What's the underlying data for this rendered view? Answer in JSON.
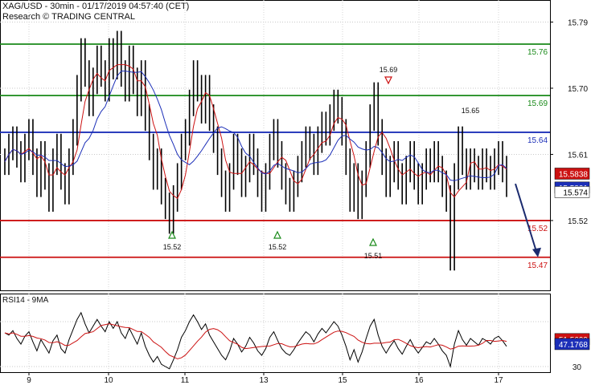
{
  "header": {
    "line1": "XAG/USD - 30min - 01/17/2019 04:57:40 (CET)",
    "line2": "Research © TRADING CENTRAL"
  },
  "chart_data": [
    {
      "type": "line",
      "title": "XAG/USD - 30min",
      "ylim": [
        15.425,
        15.82
      ],
      "y_ticks": [
        "15.79",
        "15.70",
        "15.61",
        "15.52"
      ],
      "x_ticks": [
        "9",
        "10",
        "11",
        "13",
        "15",
        "16",
        "17"
      ],
      "grid": true,
      "series": [
        {
          "values": [
            15.6,
            15.62,
            15.63,
            15.61,
            15.59,
            15.62,
            15.64,
            15.6,
            15.57,
            15.61,
            15.58,
            15.55,
            15.6,
            15.62,
            15.58,
            15.56,
            15.6,
            15.64,
            15.7,
            15.75,
            15.72,
            15.68,
            15.71,
            15.74,
            15.72,
            15.7,
            15.75,
            15.73,
            15.76,
            15.72,
            15.7,
            15.74,
            15.71,
            15.68,
            15.72,
            15.66,
            15.62,
            15.58,
            15.6,
            15.56,
            15.54,
            15.52,
            15.55,
            15.58,
            15.62,
            15.64,
            15.68,
            15.72,
            15.7,
            15.67,
            15.7,
            15.66,
            15.63,
            15.6,
            15.57,
            15.55,
            15.58,
            15.62,
            15.6,
            15.57,
            15.59,
            15.62,
            15.6,
            15.57,
            15.55,
            15.58,
            15.62,
            15.64,
            15.61,
            15.58,
            15.56,
            15.55,
            15.57,
            15.59,
            15.61,
            15.63,
            15.62,
            15.6,
            15.63,
            15.65,
            15.64,
            15.66,
            15.68,
            15.67,
            15.64,
            15.6,
            15.55,
            15.58,
            15.54,
            15.57,
            15.61,
            15.66,
            15.69,
            15.64,
            15.6,
            15.57,
            15.59,
            15.61,
            15.58,
            15.56,
            15.59,
            15.61,
            15.58,
            15.56,
            15.58,
            15.6,
            15.59,
            15.61,
            15.59,
            15.57,
            15.55,
            15.47,
            15.58,
            15.63,
            15.6,
            15.58,
            15.6,
            15.59,
            15.58,
            15.6,
            15.59,
            15.58,
            15.6,
            15.61,
            15.59,
            15.57
          ]
        },
        {
          "name": "RSI14",
          "values": [
            60,
            58,
            62,
            55,
            50,
            57,
            61,
            52,
            44,
            54,
            48,
            42,
            53,
            58,
            46,
            42,
            54,
            63,
            72,
            78,
            68,
            60,
            66,
            72,
            66,
            61,
            70,
            64,
            70,
            60,
            55,
            64,
            57,
            50,
            60,
            48,
            40,
            34,
            39,
            32,
            30,
            28,
            36,
            45,
            56,
            62,
            70,
            76,
            70,
            63,
            68,
            58,
            52,
            46,
            40,
            36,
            44,
            55,
            50,
            43,
            48,
            56,
            51,
            44,
            40,
            46,
            56,
            61,
            53,
            46,
            42,
            40,
            45,
            51,
            56,
            61,
            58,
            52,
            59,
            64,
            60,
            65,
            70,
            66,
            58,
            48,
            36,
            45,
            34,
            43,
            55,
            66,
            72,
            58,
            48,
            42,
            48,
            53,
            46,
            41,
            48,
            54,
            47,
            42,
            47,
            52,
            50,
            55,
            50,
            44,
            40,
            30,
            50,
            62,
            54,
            49,
            55,
            52,
            49,
            55,
            53,
            50,
            55,
            57,
            53,
            48
          ]
        }
      ],
      "price_axis_labels": {
        "last": "15.574",
        "ma1": "15.5838",
        "ma2": "15.5801"
      },
      "rsi": {
        "label": "RSI14 - 9MA",
        "ylim": [
          25,
          95
        ],
        "tick": "30",
        "last": "47.1768",
        "ma_last": "51.5699"
      },
      "levels": [
        {
          "value": 15.76,
          "label": "15.76",
          "kind": "resistance",
          "color": "#1a8a1a"
        },
        {
          "value": 15.69,
          "label": "15.69",
          "kind": "resistance",
          "color": "#1a8a1a"
        },
        {
          "value": 15.64,
          "label": "15.64",
          "kind": "pivot",
          "color": "#1c2fb8"
        },
        {
          "value": 15.52,
          "label": "15.52",
          "kind": "support",
          "color": "#cc1111"
        },
        {
          "value": 15.47,
          "label": "15.47",
          "kind": "support",
          "color": "#cc1111"
        }
      ],
      "annotations": [
        {
          "text": "15.52",
          "marker": "up"
        },
        {
          "text": "15.52",
          "marker": "up"
        },
        {
          "text": "15.51",
          "marker": "up"
        },
        {
          "text": "15.69",
          "marker": "down"
        },
        {
          "text": "15.65",
          "marker": "none"
        }
      ],
      "forecast_arrow": {
        "from": 15.57,
        "to": 15.47
      }
    }
  ]
}
